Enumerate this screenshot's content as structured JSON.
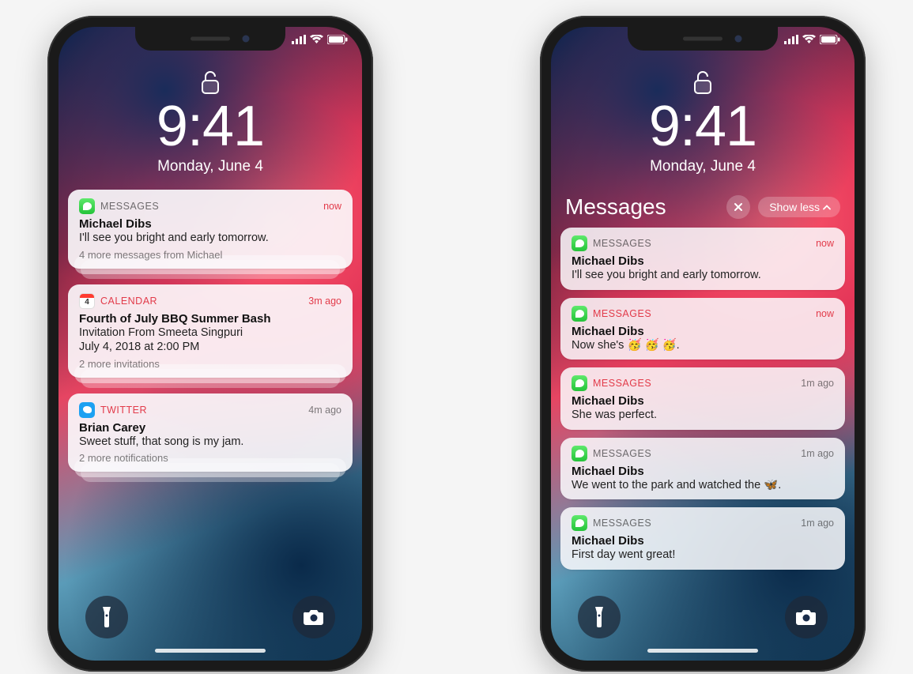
{
  "status": {
    "time": "9:41",
    "date": "Monday, June 4"
  },
  "left": {
    "cards": [
      {
        "app": "MESSAGES",
        "icon": "messages",
        "ts": "now",
        "tsRed": true,
        "nameRed": false,
        "sender": "Michael Dibs",
        "body": "I'll see you bright and early tomorrow.",
        "more": "4 more messages from Michael"
      },
      {
        "app": "CALENDAR",
        "icon": "calendar",
        "iconDay": "4",
        "ts": "3m ago",
        "tsRed": true,
        "nameRed": true,
        "sender": "Fourth of July BBQ Summer Bash",
        "body": "Invitation From Smeeta Singpuri\nJuly 4, 2018 at 2:00 PM",
        "more": "2 more invitations"
      },
      {
        "app": "TWITTER",
        "icon": "twitter",
        "ts": "4m ago",
        "tsRed": false,
        "nameRed": true,
        "sender": "Brian Carey",
        "body": "Sweet stuff, that song is my jam.",
        "more": "2 more notifications"
      }
    ]
  },
  "right": {
    "groupTitle": "Messages",
    "showLess": "Show less",
    "cards": [
      {
        "app": "MESSAGES",
        "ts": "now",
        "tsRed": true,
        "nameRed": false,
        "sender": "Michael Dibs",
        "body": "I'll see you bright and early tomorrow."
      },
      {
        "app": "MESSAGES",
        "ts": "now",
        "tsRed": true,
        "nameRed": true,
        "sender": "Michael Dibs",
        "body": "Now she's 🥳 🥳 🥳."
      },
      {
        "app": "MESSAGES",
        "ts": "1m ago",
        "tsRed": false,
        "nameRed": true,
        "sender": "Michael Dibs",
        "body": "She was perfect."
      },
      {
        "app": "MESSAGES",
        "ts": "1m ago",
        "tsRed": false,
        "nameRed": false,
        "sender": "Michael Dibs",
        "body": "We went to the park and watched the 🦋."
      },
      {
        "app": "MESSAGES",
        "ts": "1m ago",
        "tsRed": false,
        "nameRed": false,
        "sender": "Michael Dibs",
        "body": "First day went great!"
      }
    ]
  }
}
